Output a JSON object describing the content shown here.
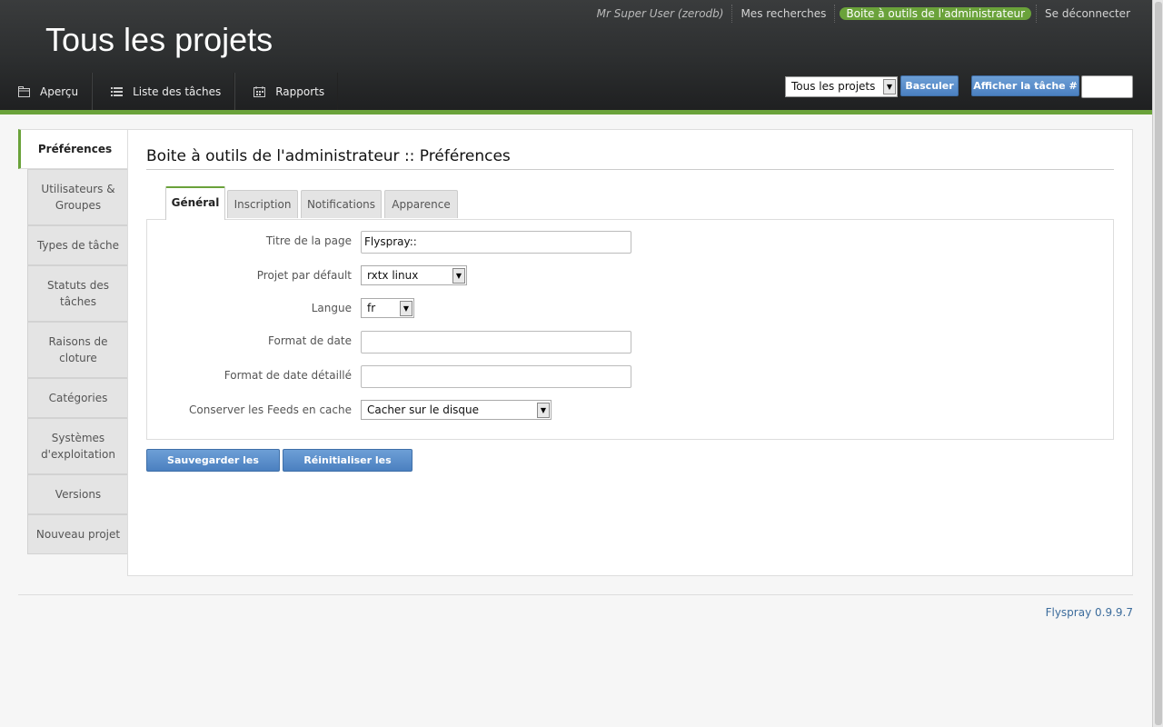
{
  "header": {
    "user": "Mr Super User (zerodb)",
    "links": [
      "Mes recherches",
      "Boite à outils de l'administrateur",
      "Se déconnecter"
    ],
    "title": "Tous les projets",
    "nav": [
      "Aperçu",
      "Liste des tâches",
      "Rapports"
    ],
    "project_select": "Tous les projets",
    "switch_button": "Basculer",
    "show_task_button": "Afficher la tâche #",
    "task_input_value": ""
  },
  "sidebar": {
    "items": [
      "Préférences",
      "Utilisateurs & Groupes",
      "Types de tâche",
      "Statuts des tâches",
      "Raisons de cloture",
      "Catégories",
      "Systèmes d'exploitation",
      "Versions",
      "Nouveau projet"
    ],
    "active_index": 0
  },
  "main": {
    "heading": "Boite à outils de l'administrateur :: Préférences",
    "tabs": [
      "Général",
      "Inscription",
      "Notifications",
      "Apparence"
    ],
    "active_tab": 0,
    "form": {
      "page_title_label": "Titre de la page",
      "page_title_value": "Flyspray::",
      "default_project_label": "Projet par défault",
      "default_project_value": "rxtx linux",
      "language_label": "Langue",
      "language_value": "fr",
      "date_format_label": "Format de date",
      "date_format_value": "",
      "date_format_detailed_label": "Format de date détaillé",
      "date_format_detailed_value": "",
      "feed_cache_label": "Conserver les Feeds en cache",
      "feed_cache_value": "Cacher sur le disque"
    },
    "save_button": "Sauvegarder les options",
    "reset_button": "Réinitialiser les options"
  },
  "footer": {
    "version": "Flyspray 0.9.9.7"
  },
  "colors": {
    "accent_green": "#6aa23a",
    "button_blue": "#4b80c0",
    "header_dark": "#2c2e2f"
  }
}
